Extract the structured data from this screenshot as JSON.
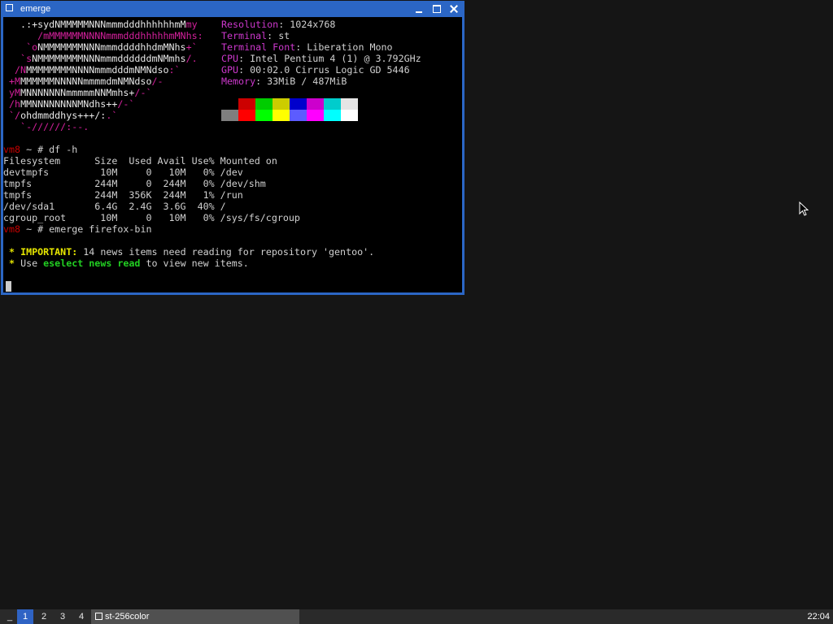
{
  "window": {
    "title": "emerge",
    "icons": {
      "app": "window-icon",
      "minimize": "minimize-icon",
      "maximize": "maximize-icon",
      "close": "close-icon"
    },
    "colors": {
      "border": "#2b66c5",
      "background": "#000000"
    }
  },
  "terminal": {
    "logo": [
      [
        "   .:",
        "+sydNMMMMMNNNmmmdddhhhhhhmM",
        "my"
      ],
      [
        "      ",
        "/mMMMMMMNNNNmmmdddhhhhhmMNh",
        "s:"
      ],
      [
        "    `o",
        "NMMMMMMMNNNmmmddddhhdmMNhs",
        "+`"
      ],
      [
        "   `s",
        "NMMMMMMMMNNNmmmddddddmNMmhs",
        "/."
      ],
      [
        "  /N",
        "MMMMMMMMNNNNmmmdddmNMNdso",
        ":`"
      ],
      [
        " +M",
        "MMMMMMNNNNNmmmmdmNMNdso",
        "/-"
      ],
      [
        " yM",
        "MNNNNNNNmmmmmNNMmhs+",
        "/-`"
      ],
      [
        " /h",
        "MMNNNNNNNNMNdhs++",
        "/-`"
      ],
      [
        " `/",
        "ohdmmddhys+++/:",
        ".`"
      ],
      [
        "   `",
        "-//////:--.",
        ""
      ]
    ],
    "sysinfo": [
      {
        "key": "Resolution",
        "value": "1024x768"
      },
      {
        "key": "Terminal",
        "value": "st"
      },
      {
        "key": "Terminal Font",
        "value": "Liberation Mono"
      },
      {
        "key": "CPU",
        "value": "Intel Pentium 4 (1) @ 3.792GHz"
      },
      {
        "key": "GPU",
        "value": "00:02.0 Cirrus Logic GD 5446"
      },
      {
        "key": "Memory",
        "value": "33MiB / 487MiB"
      }
    ],
    "palette_top": [
      "#000000",
      "#cc0000",
      "#00cc00",
      "#cccc00",
      "#0000cc",
      "#cc00cc",
      "#00cccc",
      "#e5e5e5"
    ],
    "palette_bottom": [
      "#7f7f7f",
      "#ff0000",
      "#00ff00",
      "#ffff00",
      "#5c5cff",
      "#ff00ff",
      "#00ffff",
      "#ffffff"
    ],
    "prompt1": {
      "host": "vm8",
      "path": " ~ # ",
      "command": "df -h"
    },
    "df_header": "Filesystem      Size  Used Avail Use% Mounted on",
    "df_rows": [
      "devtmpfs         10M     0   10M   0% /dev",
      "tmpfs           244M     0  244M   0% /dev/shm",
      "tmpfs           244M  356K  244M   1% /run",
      "/dev/sda1       6.4G  2.4G  3.6G  40% /",
      "cgroup_root      10M     0   10M   0% /sys/fs/cgroup"
    ],
    "prompt2": {
      "host": "vm8",
      "path": " ~ # ",
      "command": "emerge firefox-bin"
    },
    "news1": {
      "star": " * ",
      "label": "IMPORTANT:",
      "text": " 14 news items need reading for repository 'gentoo'."
    },
    "news2": {
      "star": " * ",
      "pre": "Use ",
      "command": "eselect news read",
      "post": " to view new items."
    }
  },
  "taskbar": {
    "menu": "_",
    "workspaces": [
      "1",
      "2",
      "3",
      "4"
    ],
    "active_workspace": "1",
    "task": {
      "icon": "window-icon",
      "label": "st-256color"
    },
    "clock": "22:04",
    "colors": {
      "bar": "#2a2a2a",
      "active": "#2f63c4",
      "task": "#505050"
    }
  },
  "pointer": {
    "icon": "mouse-pointer-icon"
  }
}
